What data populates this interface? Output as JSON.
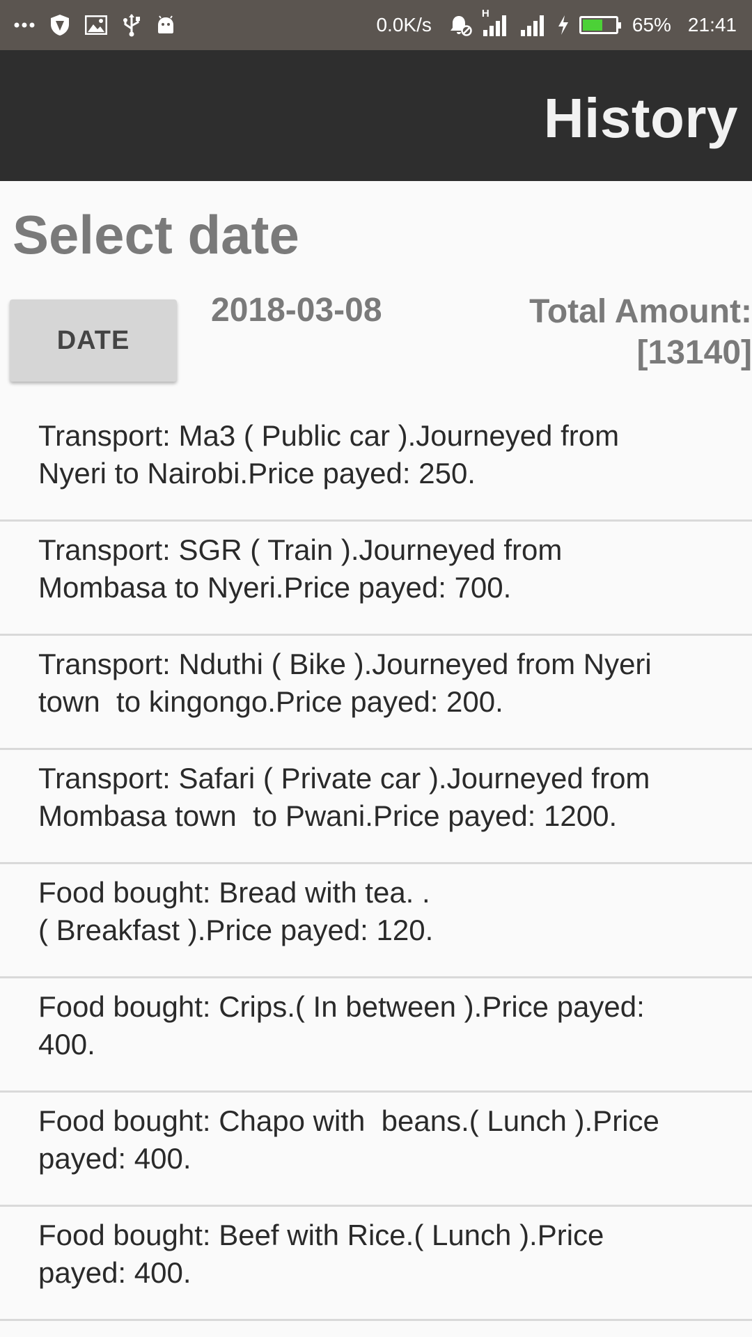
{
  "status_bar": {
    "net_speed": "0.0K/s",
    "signal_label": "H",
    "battery_percent": "65%",
    "battery_level": 0.65,
    "time": "21:41",
    "icons_left": [
      "more-dots-icon",
      "shield-icon",
      "image-icon",
      "usb-icon",
      "android-icon"
    ],
    "icons_right": [
      "bell-off-icon",
      "signal-icon",
      "signal-icon",
      "charging-icon",
      "battery-icon"
    ]
  },
  "appbar": {
    "title": "History"
  },
  "main": {
    "section_title": "Select date",
    "date_button_label": "DATE",
    "selected_date": "2018-03-08",
    "total_label": "Total Amount:",
    "total_value": "[13140]"
  },
  "entries": [
    "Transport: Ma3 ( Public car ).Journeyed from\nNyeri to Nairobi.Price payed: 250.",
    "Transport: SGR ( Train ).Journeyed from\nMombasa to Nyeri.Price payed: 700.",
    "Transport: Nduthi ( Bike ).Journeyed from Nyeri\ntown  to kingongo.Price payed: 200.",
    "Transport: Safari ( Private car ).Journeyed from\nMombasa town  to Pwani.Price payed: 1200.",
    "Food bought: Bread with tea. .\n( Breakfast ).Price payed: 120.",
    "Food bought: Crips.( In between ).Price payed:\n400.",
    "Food bought: Chapo with  beans.( Lunch ).Price\npayed: 400.",
    "Food bought: Beef with Rice.( Lunch ).Price\npayed: 400."
  ],
  "colors": {
    "status_bar_bg": "#5b5550",
    "appbar_bg": "#2e2e2e",
    "battery_fill": "#4cd137",
    "heading_gray": "#7a7a7a"
  }
}
